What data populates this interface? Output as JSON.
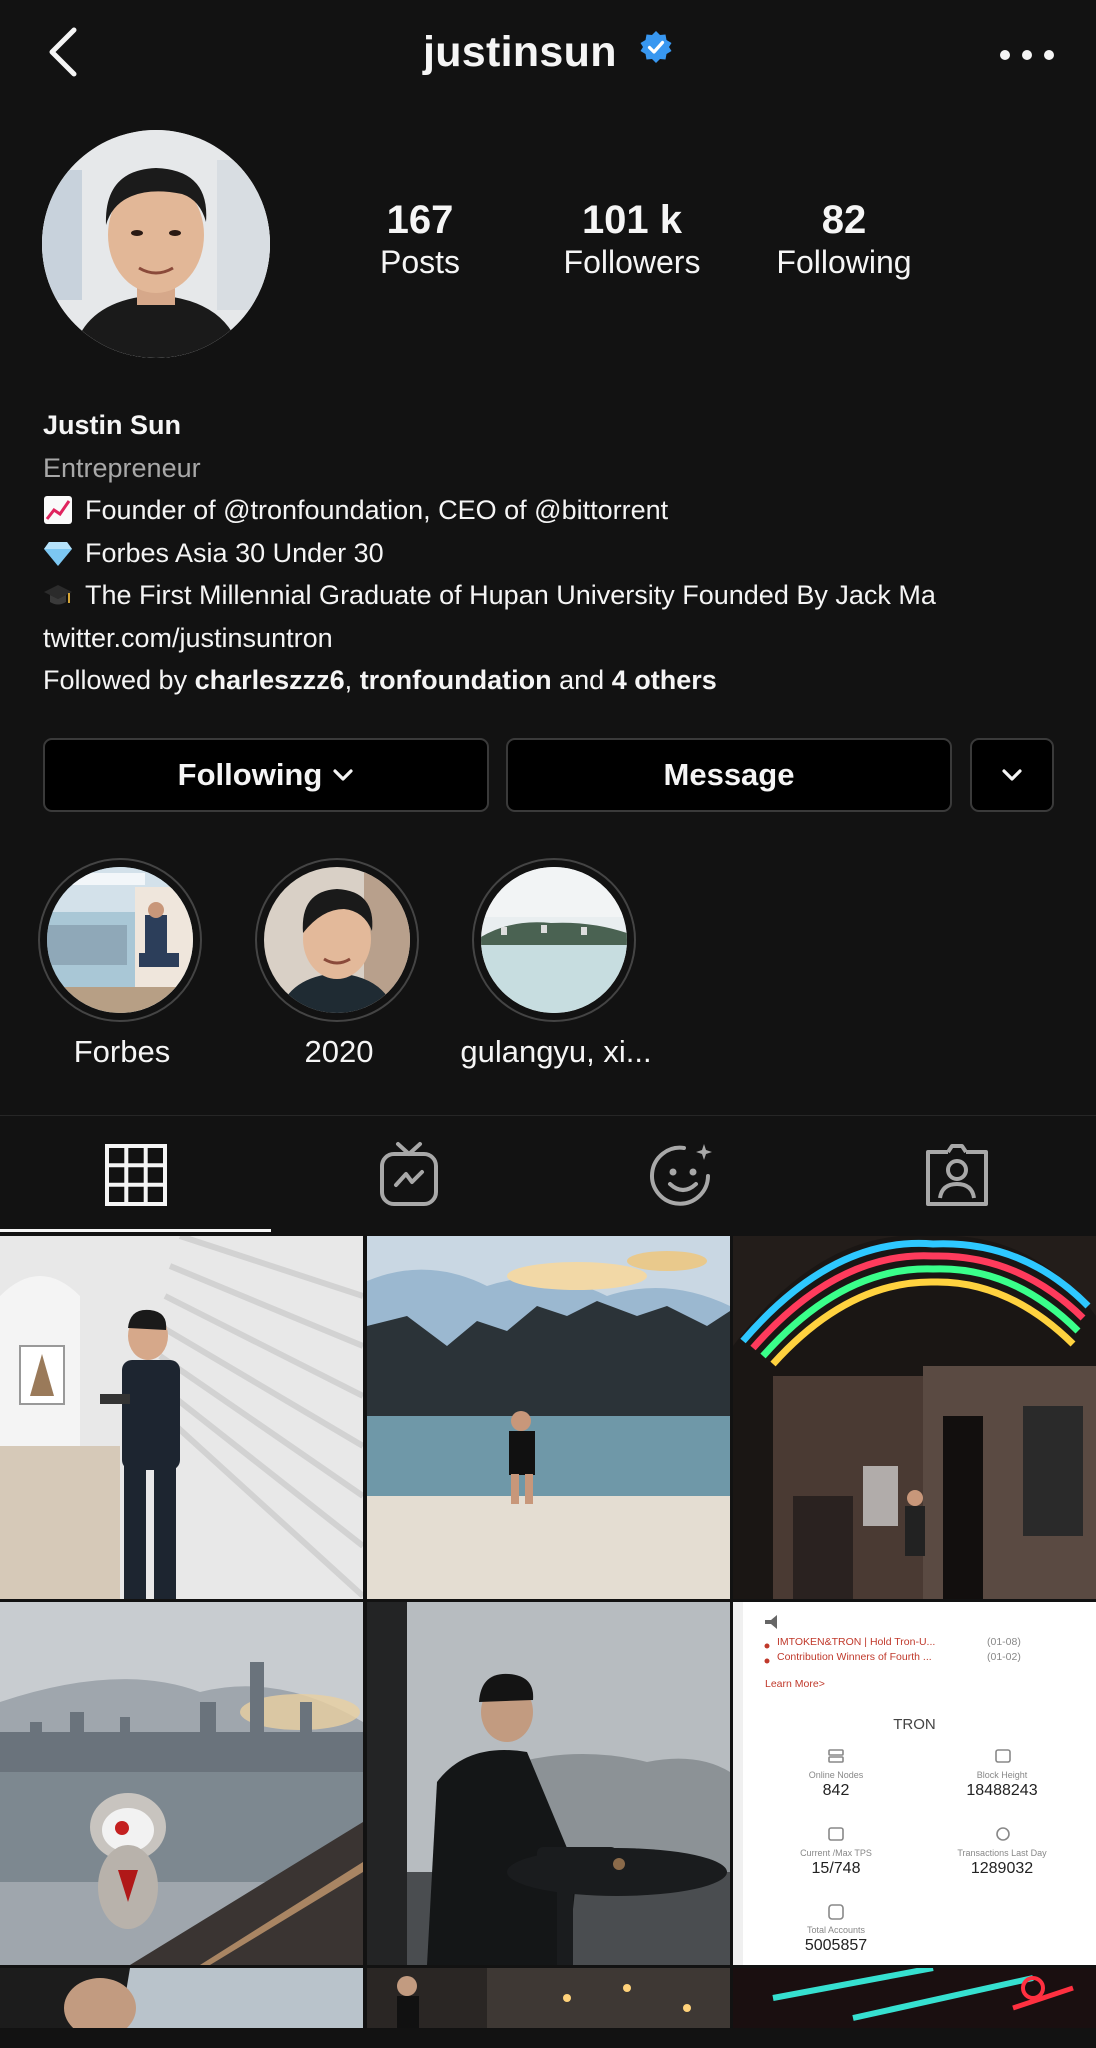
{
  "header": {
    "username": "justinsun",
    "back_icon": "chevron-left-icon",
    "verified_icon": "verified-badge-icon",
    "more_icon": "more-horizontal-icon"
  },
  "stats": [
    {
      "value": "167",
      "label": "Posts"
    },
    {
      "value": "101 k",
      "label": "Followers"
    },
    {
      "value": "82",
      "label": "Following"
    }
  ],
  "bio": {
    "name": "Justin Sun",
    "category": "Entrepreneur",
    "lines": [
      {
        "icon": "chart-increasing-emoji",
        "text": "Founder of @tronfoundation, CEO of @bittorrent"
      },
      {
        "icon": "gem-stone-emoji",
        "text": "Forbes Asia 30 Under 30"
      },
      {
        "icon": "graduation-cap-emoji",
        "text": "The First Millennial Graduate of Hupan University Founded By Jack Ma"
      }
    ],
    "link": "twitter.com/justinsuntron",
    "followed_by": {
      "prefix": "Followed by ",
      "user1": "charleszzz6",
      "sep": ", ",
      "user2": "tronfoundation",
      "and": " and ",
      "others": "4 others"
    }
  },
  "actions": {
    "following_label": "Following",
    "message_label": "Message"
  },
  "highlights": [
    {
      "label": "Forbes"
    },
    {
      "label": "2020"
    },
    {
      "label": "gulangyu, xi..."
    }
  ],
  "tabs": [
    {
      "icon": "grid-icon",
      "active": true
    },
    {
      "icon": "igtv-icon",
      "active": false
    },
    {
      "icon": "reels-effects-icon",
      "active": false
    },
    {
      "icon": "tagged-icon",
      "active": false
    }
  ],
  "tron_post": {
    "news1": "IMTOKEN&TRON | Hold Tron-U...",
    "news1_date": "(01-08)",
    "news2": "Contribution Winners of Fourth ...",
    "news2_date": "(01-02)",
    "learn_more": "Learn More>",
    "title": "TRON",
    "online_nodes_label": "Online Nodes",
    "online_nodes": "842",
    "block_height_label": "Block Height",
    "block_height": "18488243",
    "tps_label": "Current /Max TPS",
    "tps": "15/748",
    "tx_label": "Transactions Last Day",
    "tx": "1289032",
    "accounts_label": "Total Accounts",
    "accounts": "5005857"
  },
  "colors": {
    "background": "#121212",
    "text": "#f5f5f5",
    "muted": "#a8a8a8",
    "verified": "#3897f0",
    "button_border": "#3a3a3a"
  }
}
